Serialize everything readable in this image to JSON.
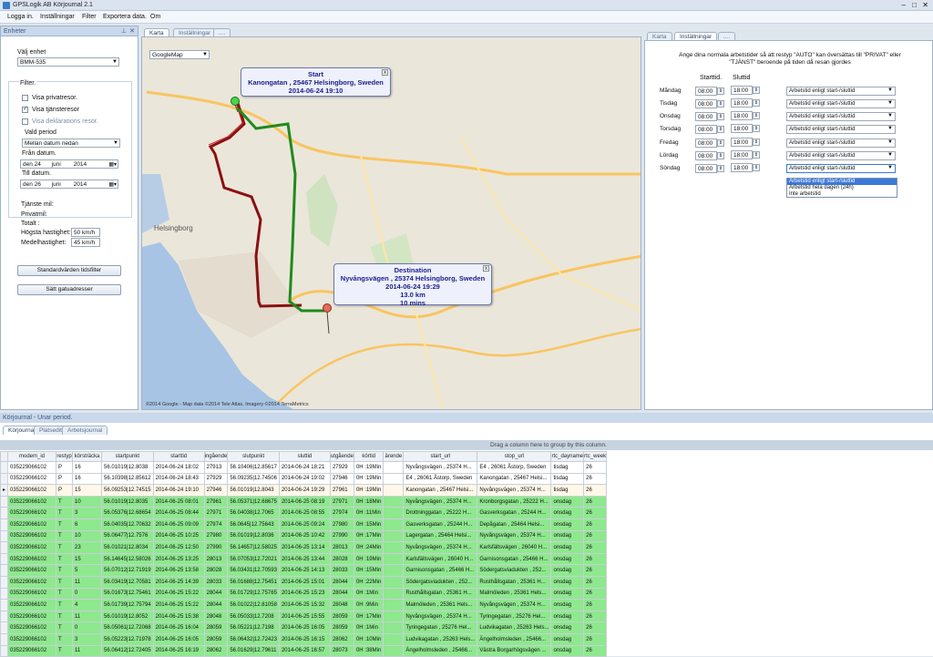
{
  "window": {
    "title": "GPSLogik AB Körjournal 2.1"
  },
  "menu": [
    "Logga in.",
    "Inställningar",
    "Filter",
    "Exportera data.",
    "Om"
  ],
  "left_panel": {
    "header": "Enheter",
    "unit_label": "Välj enhet",
    "unit_value": "BMM-535",
    "filter_label": "Filter.",
    "checks": [
      {
        "label": "Visa privatresor.",
        "checked": false
      },
      {
        "label": "Visa tjänsteresor",
        "checked": true
      },
      {
        "label": "Visa deklarations resor.",
        "checked": false
      }
    ],
    "period_label": "Vald period",
    "period_value": "Mellan datum nedan",
    "from_label": "Från datum.",
    "from_date": {
      "day": "den 24",
      "month": "juni",
      "year": "2014"
    },
    "to_label": "Till datum.",
    "to_date": {
      "day": "den 26",
      "month": "juni",
      "year": "2014"
    },
    "stats": {
      "service_km": "Tjänste mil:",
      "private_km": "Privatmil:",
      "total": "Totalt :",
      "max_speed_label": "Högsta hastighet:",
      "max_speed": "50 km/h",
      "avg_speed_label": "Medelhastighet:",
      "avg_speed": "45 km/h"
    },
    "buttons": [
      "Standardvärden tidsfilter",
      "Sätt gatuadresser"
    ]
  },
  "map_tabs": [
    "Karta",
    "Inställningar",
    "...."
  ],
  "map": {
    "type_select": "GoogleMap",
    "copyright": "©2014 Google - Map data ©2014 Tele Atlas, Imagery ©2014 TerraMetrics",
    "city_label": "Helsingborg",
    "start": {
      "title": "Start",
      "address": "Kanongatan , 25467 Helsingborg, Sweden",
      "time": "2014-06-24 19:10"
    },
    "destination": {
      "title": "Destination",
      "address": "Nyvångsvägen , 25374 Helsingborg, Sweden",
      "time": "2014-06-24 19:29",
      "distance": "13.0 km",
      "duration": "10 mins"
    }
  },
  "settings_tabs": [
    "Karta",
    "Inställningar",
    "...."
  ],
  "settings": {
    "info": "Ange dina normala arbetstider så att restyp \"AUTO\" kan översättas till \"PRIVAT\" eller \"TJÄNST\" beroende på tiden då resan gjordes",
    "start_header": "Starttid.",
    "end_header": "Sluttid",
    "days": [
      {
        "day": "Måndag",
        "start": "08:00",
        "end": "18:00",
        "rule": "Arbetstid enligt start-/sluttid"
      },
      {
        "day": "Tisdag",
        "start": "08:00",
        "end": "18:00",
        "rule": "Arbetstid enligt start-/sluttid"
      },
      {
        "day": "Onsdag",
        "start": "08:00",
        "end": "18:00",
        "rule": "Arbetstid enligt start-/sluttid"
      },
      {
        "day": "Torsdag",
        "start": "08:00",
        "end": "18:00",
        "rule": "Arbetstid enligt start-/sluttid"
      },
      {
        "day": "Fredag",
        "start": "08:00",
        "end": "18:00",
        "rule": "Arbetstid enligt start-/sluttid"
      },
      {
        "day": "Lördag",
        "start": "08:00",
        "end": "18:00",
        "rule": "Arbetstid enligt start-/sluttid"
      },
      {
        "day": "Söndag",
        "start": "08:00",
        "end": "18:00",
        "rule": "Arbetstid enligt start-/sluttid"
      }
    ],
    "dropdown_options": [
      "Arbetstid enligt start-/sluttid",
      "Arbetstid hela dagen (24h)",
      "Inte arbetstid"
    ]
  },
  "bottom": {
    "header": "Körjournal - Unar period.",
    "tabs": [
      "Körjournal",
      "Platseditor",
      "Arbetsjournal"
    ],
    "group_hint": "Drag a column here to group by this column.",
    "columns": [
      "modem_id",
      "restyp",
      "körsträcka",
      "startpunkt",
      "starttid",
      "ingående",
      "slutpunkt",
      "sluttid",
      "utgående",
      "körtid",
      "ärende",
      "start_url",
      "stop_url",
      "rtc_dayname",
      "rtc_week"
    ],
    "rows": [
      {
        "style": "white",
        "cells": [
          "035229066102",
          "P",
          "16",
          "56.01019|12.8038",
          "2014-06-24 18:02",
          "27913",
          "56.10406|12.85617",
          "2014-06-24 18:21",
          "27929",
          "0H :19Min",
          "",
          "Nyvångsvägen , 25374 H...",
          "E4 , 26061 Åstorp, Sweden",
          "tisdag",
          "26"
        ]
      },
      {
        "style": "white",
        "cells": [
          "035229066102",
          "P",
          "16",
          "56.10398|12.85612",
          "2014-06-24 18:43",
          "27929",
          "56.09235|12.74506",
          "2014-06-24 19:02",
          "27946",
          "0H :19Min",
          "",
          "E4 , 26061 Åstorp, Sweden",
          "Kanongatan , 25467 Helsi...",
          "tisdag",
          "26"
        ]
      },
      {
        "style": "sel",
        "cells": [
          "035229066102",
          "P",
          "15",
          "56.09253|12.74515",
          "2014-06-24 19:10",
          "27946",
          "56.01019|12.8043",
          "2014-06-24 19:29",
          "27961",
          "0H :19Min",
          "",
          "Kanongatan , 25467 Helsi...",
          "Nyvångsvägen , 25374 H...",
          "tisdag",
          "26"
        ]
      },
      {
        "style": "green",
        "cells": [
          "035229066102",
          "T",
          "10",
          "56.01019|12.8035",
          "2014-06-25 08:01",
          "27961",
          "56.05371|12.68675",
          "2014-06-25 08:19",
          "27971",
          "0H :18Min",
          "",
          "Nyvångsvägen , 25374 H...",
          "Kronborgsgatan , 25222 H...",
          "onsdag",
          "26"
        ]
      },
      {
        "style": "green",
        "cells": [
          "035229066102",
          "T",
          "3",
          "56.05376|12.68654",
          "2014-06-25 08:44",
          "27971",
          "56.04038|12.7065",
          "2014-06-25 08:55",
          "27974",
          "0H :11Min",
          "",
          "Drottninggatan , 25222 H...",
          "Gasverksgatan , 25244 H...",
          "onsdag",
          "26"
        ]
      },
      {
        "style": "green",
        "cells": [
          "035229066102",
          "T",
          "6",
          "56.04035|12.70632",
          "2014-06-25 09:09",
          "27974",
          "56.0645|12.75643",
          "2014-06-25 09:24",
          "27980",
          "0H :15Min",
          "",
          "Gasverksgatan , 25244 H...",
          "Depågatan , 25464 Helsi...",
          "onsdag",
          "26"
        ]
      },
      {
        "style": "green",
        "cells": [
          "035229066102",
          "T",
          "10",
          "56.06477|12.7576",
          "2014-06-25 10:25",
          "27980",
          "56.01019|12.8036",
          "2014-06-25 10:42",
          "27990",
          "0H :17Min",
          "",
          "Lagergatan , 25464 Helsi...",
          "Nyvångsvägen , 25374 H...",
          "onsdag",
          "26"
        ]
      },
      {
        "style": "green",
        "cells": [
          "035229066102",
          "T",
          "23",
          "56.01021|12.8034",
          "2014-06-25 12:50",
          "27990",
          "56.14657|12.58025",
          "2014-06-25 13:14",
          "28013",
          "0H :24Min",
          "",
          "Nyvångsvägen , 25374 H...",
          "Karlsfältsvägen , 26040 H...",
          "onsdag",
          "26"
        ]
      },
      {
        "style": "green",
        "cells": [
          "035229066102",
          "T",
          "15",
          "56.14645|12.58026",
          "2014-06-25 13:25",
          "28013",
          "56.07053|12.72021",
          "2014-06-25 13:44",
          "28028",
          "0H :19Min",
          "",
          "Karlsfältsvägen , 26040 H...",
          "Garnisonsgatan , 25466 H...",
          "onsdag",
          "26"
        ]
      },
      {
        "style": "green",
        "cells": [
          "035229066102",
          "T",
          "5",
          "56.07012|12.71919",
          "2014-06-25 13:58",
          "28028",
          "56.03431|12.70593",
          "2014-06-25 14:13",
          "28033",
          "0H :15Min",
          "",
          "Garnisonsgatan , 25466 H...",
          "Södergatsviadukten , 252...",
          "onsdag",
          "26"
        ]
      },
      {
        "style": "green",
        "cells": [
          "035229066102",
          "T",
          "11",
          "56.03419|12.70581",
          "2014-06-25 14:39",
          "28033",
          "56.01688|12.75451",
          "2014-06-25 15:01",
          "28044",
          "0H :22Min",
          "",
          "Södergatsviadukten , 252...",
          "Rusthållsgatan , 25361 H...",
          "onsdag",
          "26"
        ]
      },
      {
        "style": "green",
        "cells": [
          "035229066102",
          "T",
          "0",
          "56.01673|12.75461",
          "2014-06-25 15:22",
          "28044",
          "56.01729|12.75765",
          "2014-06-25 15:23",
          "28044",
          "0H :1Min",
          "",
          "Rusthållsgatan , 25361 H...",
          "Malmöleden , 25361 Hels...",
          "onsdag",
          "26"
        ]
      },
      {
        "style": "green",
        "cells": [
          "035229066102",
          "T",
          "4",
          "56.01739|12.75794",
          "2014-06-25 15:22",
          "28044",
          "56.01022|12.81058",
          "2014-06-25 15:32",
          "28048",
          "0H :9Min",
          "",
          "Malmöleden , 25361 Hels...",
          "Nyvångsvägen , 25374 H...",
          "onsdag",
          "26"
        ]
      },
      {
        "style": "green",
        "cells": [
          "035229066102",
          "T",
          "11",
          "56.01019|12.8052",
          "2014-06-25 15:38",
          "28048",
          "56.05033|12.7208",
          "2014-06-25 15:55",
          "28059",
          "0H :17Min",
          "",
          "Nyvångsvägen , 25374 H...",
          "Tyringegatan , 25276 Hel...",
          "onsdag",
          "26"
        ]
      },
      {
        "style": "green",
        "cells": [
          "035229066102",
          "T",
          "0",
          "56.05061|12.72068",
          "2014-06-25 16:04",
          "28059",
          "56.05221|12.7198",
          "2014-06-25 16:05",
          "28059",
          "0H :1Min",
          "",
          "Tyringegatan , 25276 Hel...",
          "Ludvikagatan , 25263 Hels...",
          "onsdag",
          "26"
        ]
      },
      {
        "style": "green",
        "cells": [
          "035229066102",
          "T",
          "3",
          "56.05223|12.71978",
          "2014-06-25 16:05",
          "28059",
          "56.06432|12.72423",
          "2014-06-25 16:15",
          "28062",
          "0H :10Min",
          "",
          "Ludvikagatan , 25263 Hels...",
          "Ängelholmsleden , 25466...",
          "onsdag",
          "26"
        ]
      },
      {
        "style": "green",
        "cells": [
          "035229066102",
          "T",
          "11",
          "56.06412|12.72405",
          "2014-06-25 16:19",
          "28062",
          "56.01629|12.79611",
          "2014-06-25 16:57",
          "28073",
          "0H :38Min",
          "",
          "Ängelholmsleden , 25466...",
          "Västra Borgarhögsvägen ...",
          "onsdag",
          "26"
        ]
      }
    ]
  },
  "colors": {
    "route_green": "#1f8a1f",
    "route_red": "#8b1010",
    "row_green": "#8ee88e"
  }
}
